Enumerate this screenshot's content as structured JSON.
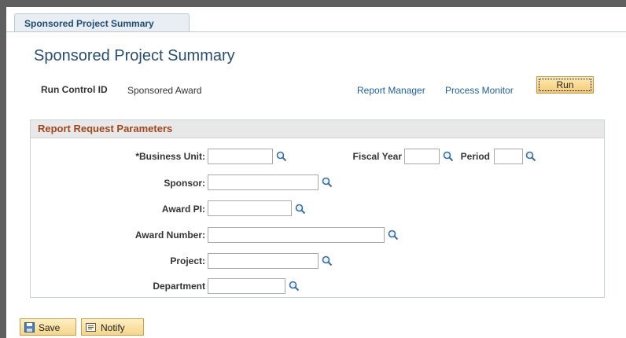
{
  "tab": {
    "label": "Sponsored Project Summary"
  },
  "page_title": "Sponsored Project Summary",
  "run_control": {
    "label": "Run Control ID",
    "value": "Sponsored Award"
  },
  "links": {
    "report_manager": "Report Manager",
    "process_monitor": "Process Monitor"
  },
  "run_button": "Run",
  "section": {
    "title": "Report Request Parameters"
  },
  "fields": {
    "business_unit": {
      "label": "*Business Unit:",
      "value": ""
    },
    "fiscal_year": {
      "label": "Fiscal Year",
      "value": ""
    },
    "period": {
      "label": "Period",
      "value": ""
    },
    "sponsor": {
      "label": "Sponsor:",
      "value": ""
    },
    "award_pi": {
      "label": "Award PI:",
      "value": ""
    },
    "award_number": {
      "label": "Award Number:",
      "value": ""
    },
    "project": {
      "label": "Project:",
      "value": ""
    },
    "department": {
      "label": "Department",
      "value": ""
    }
  },
  "buttons": {
    "save": "Save",
    "notify": "Notify"
  },
  "icons": {
    "lookup": "magnifier-icon",
    "save": "save-disk-icon",
    "notify": "notify-icon"
  },
  "colors": {
    "title": "#2a4d6d",
    "section_title": "#a0461d",
    "link": "#1f5f9a",
    "button": "#f3c974"
  }
}
